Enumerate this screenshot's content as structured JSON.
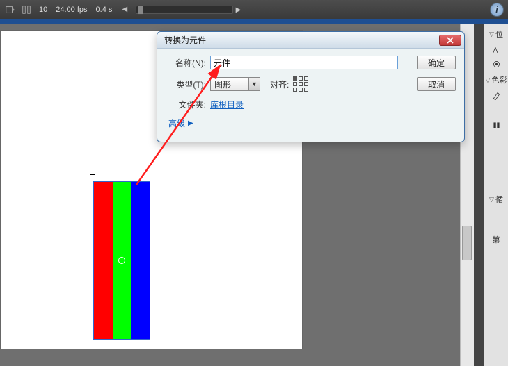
{
  "toolbar": {
    "frame": "10",
    "fps": "24.00 fps",
    "time": "0.4 s"
  },
  "dialog": {
    "title": "转换为元件",
    "name_label": "名称(N):",
    "name_value": "元件",
    "ok": "确定",
    "type_label": "类型(T):",
    "type_value": "图形",
    "align_label": "对齐:",
    "cancel": "取消",
    "folder_label": "文件夹:",
    "folder_link": "库根目录",
    "advanced": "高级"
  },
  "panels": {
    "p1": "位",
    "p2": "色彩",
    "p3": "循",
    "p4": "第"
  }
}
